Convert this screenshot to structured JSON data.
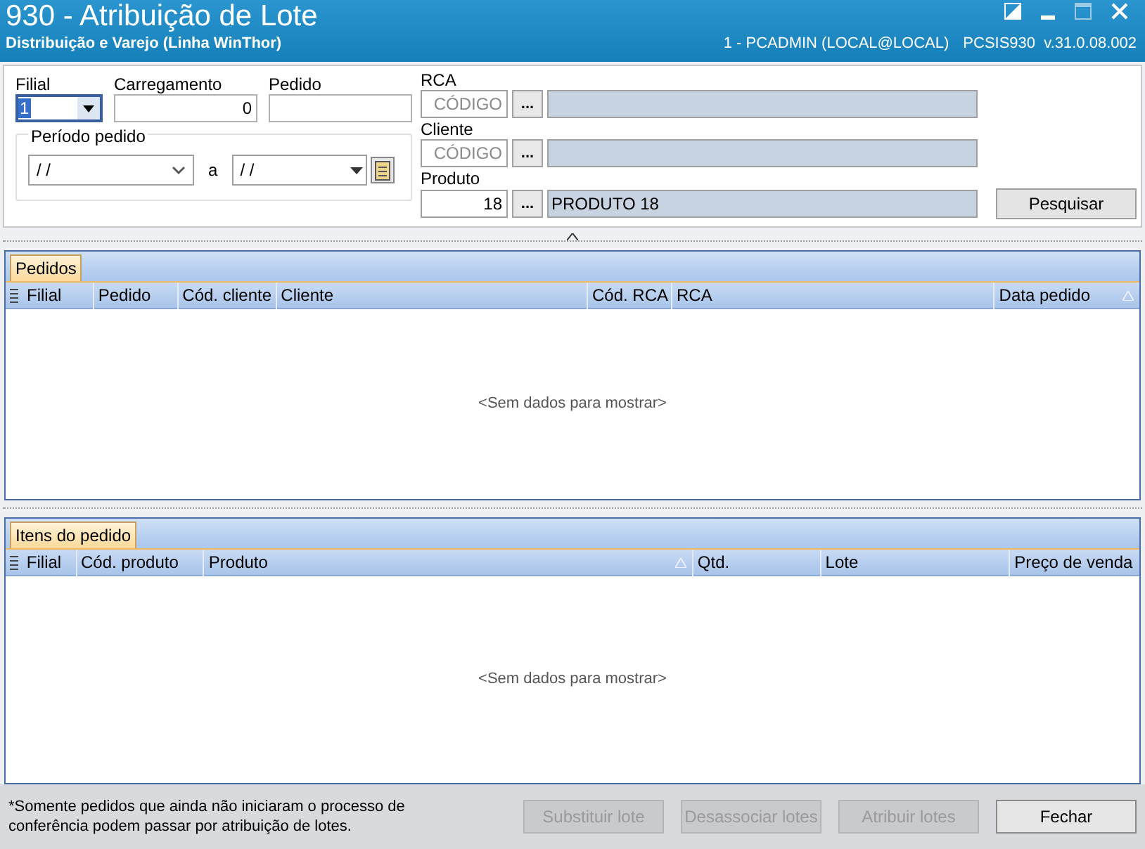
{
  "window": {
    "title": "930 - Atribuição de Lote",
    "subtitle": "Distribuição e Varejo (Linha WinThor)",
    "user": "1 - PCADMIN (LOCAL@LOCAL)",
    "version": "PCSIS930  v.31.0.08.002"
  },
  "filters": {
    "filial": {
      "label": "Filial",
      "value": "1"
    },
    "carregamento": {
      "label": "Carregamento",
      "value": "0"
    },
    "pedido": {
      "label": "Pedido"
    },
    "periodo": {
      "label": "Período pedido",
      "from": "/ /",
      "separator": "a",
      "to": "/ /"
    },
    "rca": {
      "label": "RCA",
      "code_placeholder": "CÓDIGO",
      "lookup": "..."
    },
    "cliente": {
      "label": "Cliente",
      "code_placeholder": "CÓDIGO",
      "lookup": "..."
    },
    "produto": {
      "label": "Produto",
      "code": "18",
      "lookup": "...",
      "name": "PRODUTO 18"
    },
    "search_button": "Pesquisar"
  },
  "panels": [
    {
      "tab": "Pedidos",
      "columns": [
        {
          "label": "Filial",
          "sorted": false
        },
        {
          "label": "Pedido",
          "sorted": false
        },
        {
          "label": "Cód. cliente",
          "sorted": false
        },
        {
          "label": "Cliente",
          "sorted": false
        },
        {
          "label": "Cód. RCA",
          "sorted": false
        },
        {
          "label": "RCA",
          "sorted": false
        },
        {
          "label": "Data pedido",
          "sorted": true
        }
      ],
      "empty": "<Sem dados para mostrar>"
    },
    {
      "tab": "Itens do pedido",
      "columns": [
        {
          "label": "Filial",
          "sorted": false
        },
        {
          "label": "Cód. produto",
          "sorted": false
        },
        {
          "label": "Produto",
          "sorted": true
        },
        {
          "label": "Qtd.",
          "sorted": false
        },
        {
          "label": "Lote",
          "sorted": false
        },
        {
          "label": "Preço de venda",
          "sorted": false
        }
      ],
      "empty": "<Sem dados para mostrar>"
    }
  ],
  "footer": {
    "note": "*Somente pedidos que ainda não iniciaram o processo de conferência podem passar por atribuição de lotes.",
    "buttons": [
      {
        "label": "Substituir lote",
        "disabled": true
      },
      {
        "label": "Desassociar lotes",
        "disabled": true
      },
      {
        "label": "Atribuir lotes",
        "disabled": true
      },
      {
        "label": "Fechar",
        "disabled": false
      }
    ]
  }
}
